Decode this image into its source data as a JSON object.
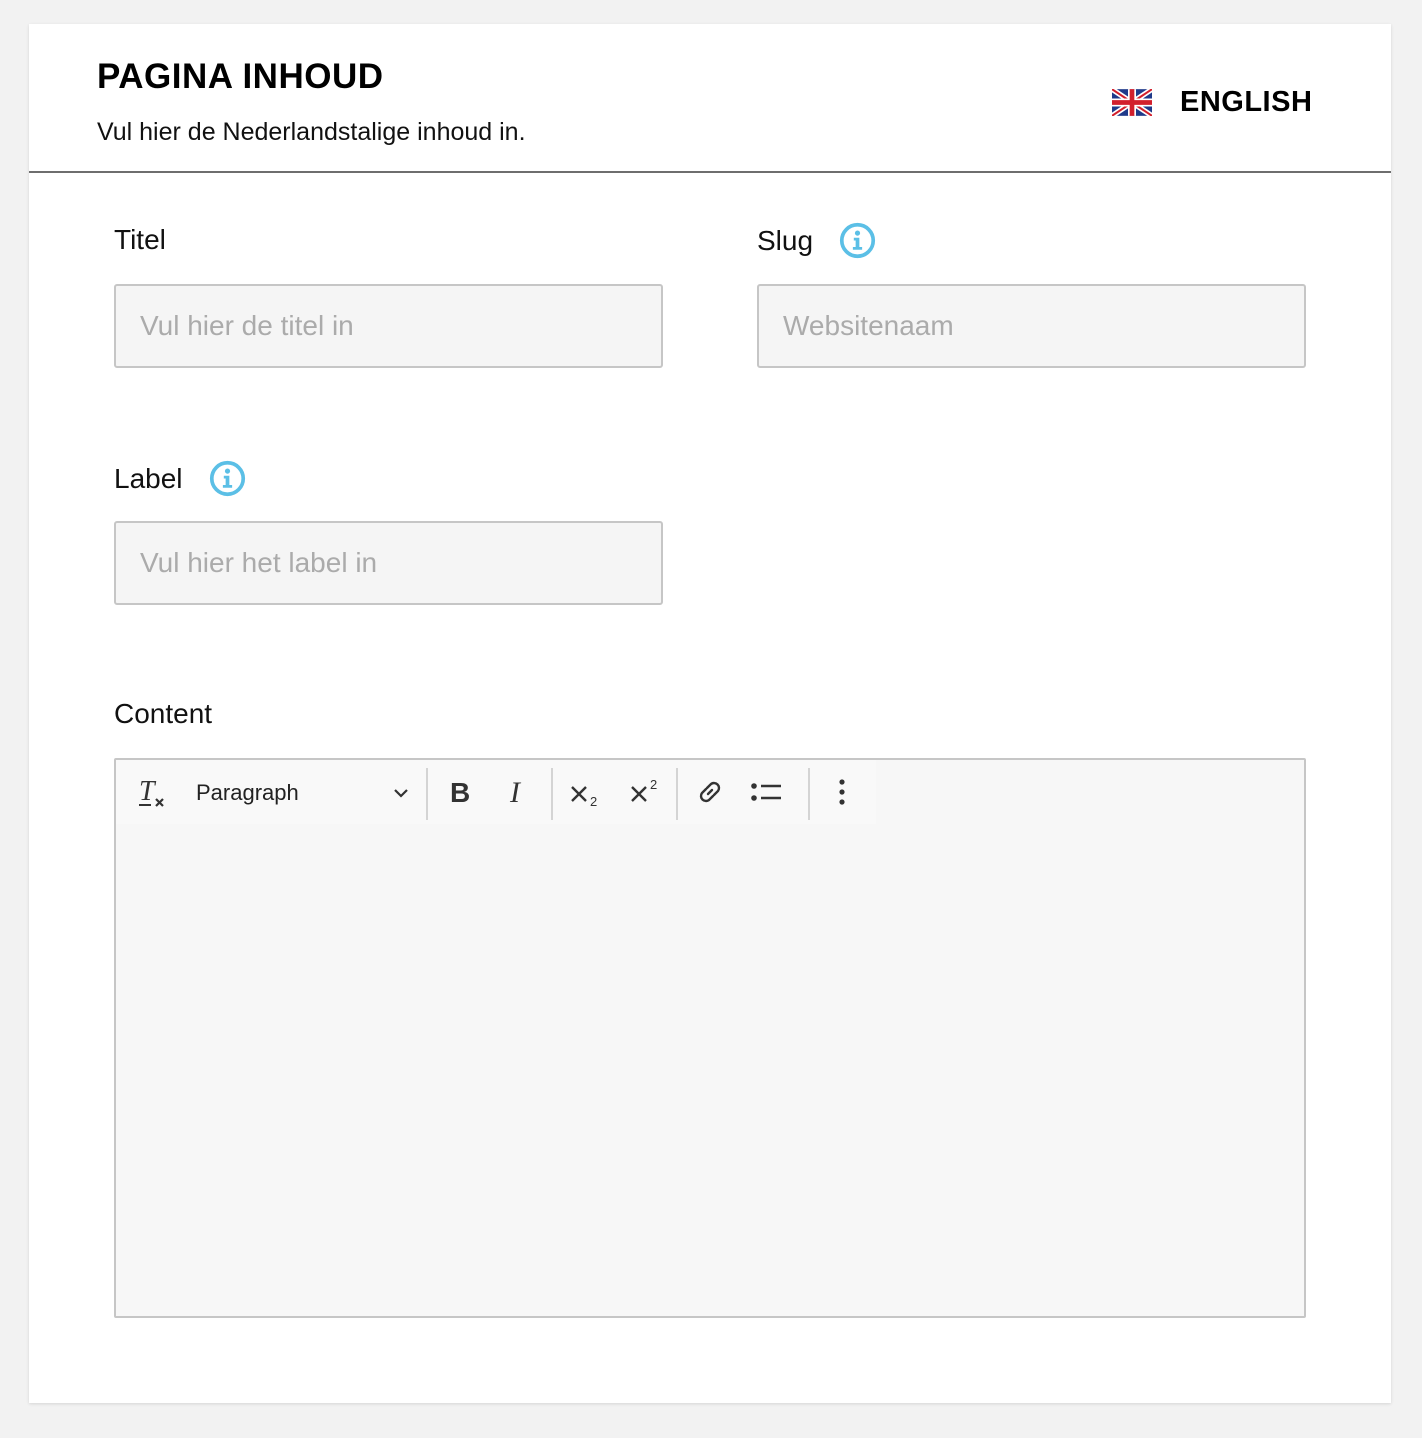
{
  "header": {
    "title": "PAGINA INHOUD",
    "subtitle": "Vul hier de Nederlandstalige inhoud in.",
    "language_switch": {
      "label": "ENGLISH",
      "flag": "uk-flag-icon"
    }
  },
  "fields": {
    "titel": {
      "label": "Titel",
      "placeholder": "Vul hier de titel in",
      "value": ""
    },
    "slug": {
      "label": "Slug",
      "placeholder": "Websitenaam",
      "value": "",
      "info_icon": "info-icon"
    },
    "label": {
      "label": "Label",
      "placeholder": "Vul hier het label in",
      "value": "",
      "info_icon": "info-icon"
    },
    "content": {
      "label": "Content",
      "value": ""
    }
  },
  "editor_toolbar": {
    "block_format": "Paragraph",
    "buttons": [
      "clear-formatting-icon",
      "bold-icon",
      "italic-icon",
      "subscript-icon",
      "superscript-icon",
      "link-icon",
      "bulleted-list-icon",
      "more-options-icon"
    ]
  },
  "colors": {
    "accent_info": "#5bbfe6",
    "divider": "#6e6e6e",
    "input_border": "#c6c6c6",
    "input_bg": "#f5f5f5"
  }
}
